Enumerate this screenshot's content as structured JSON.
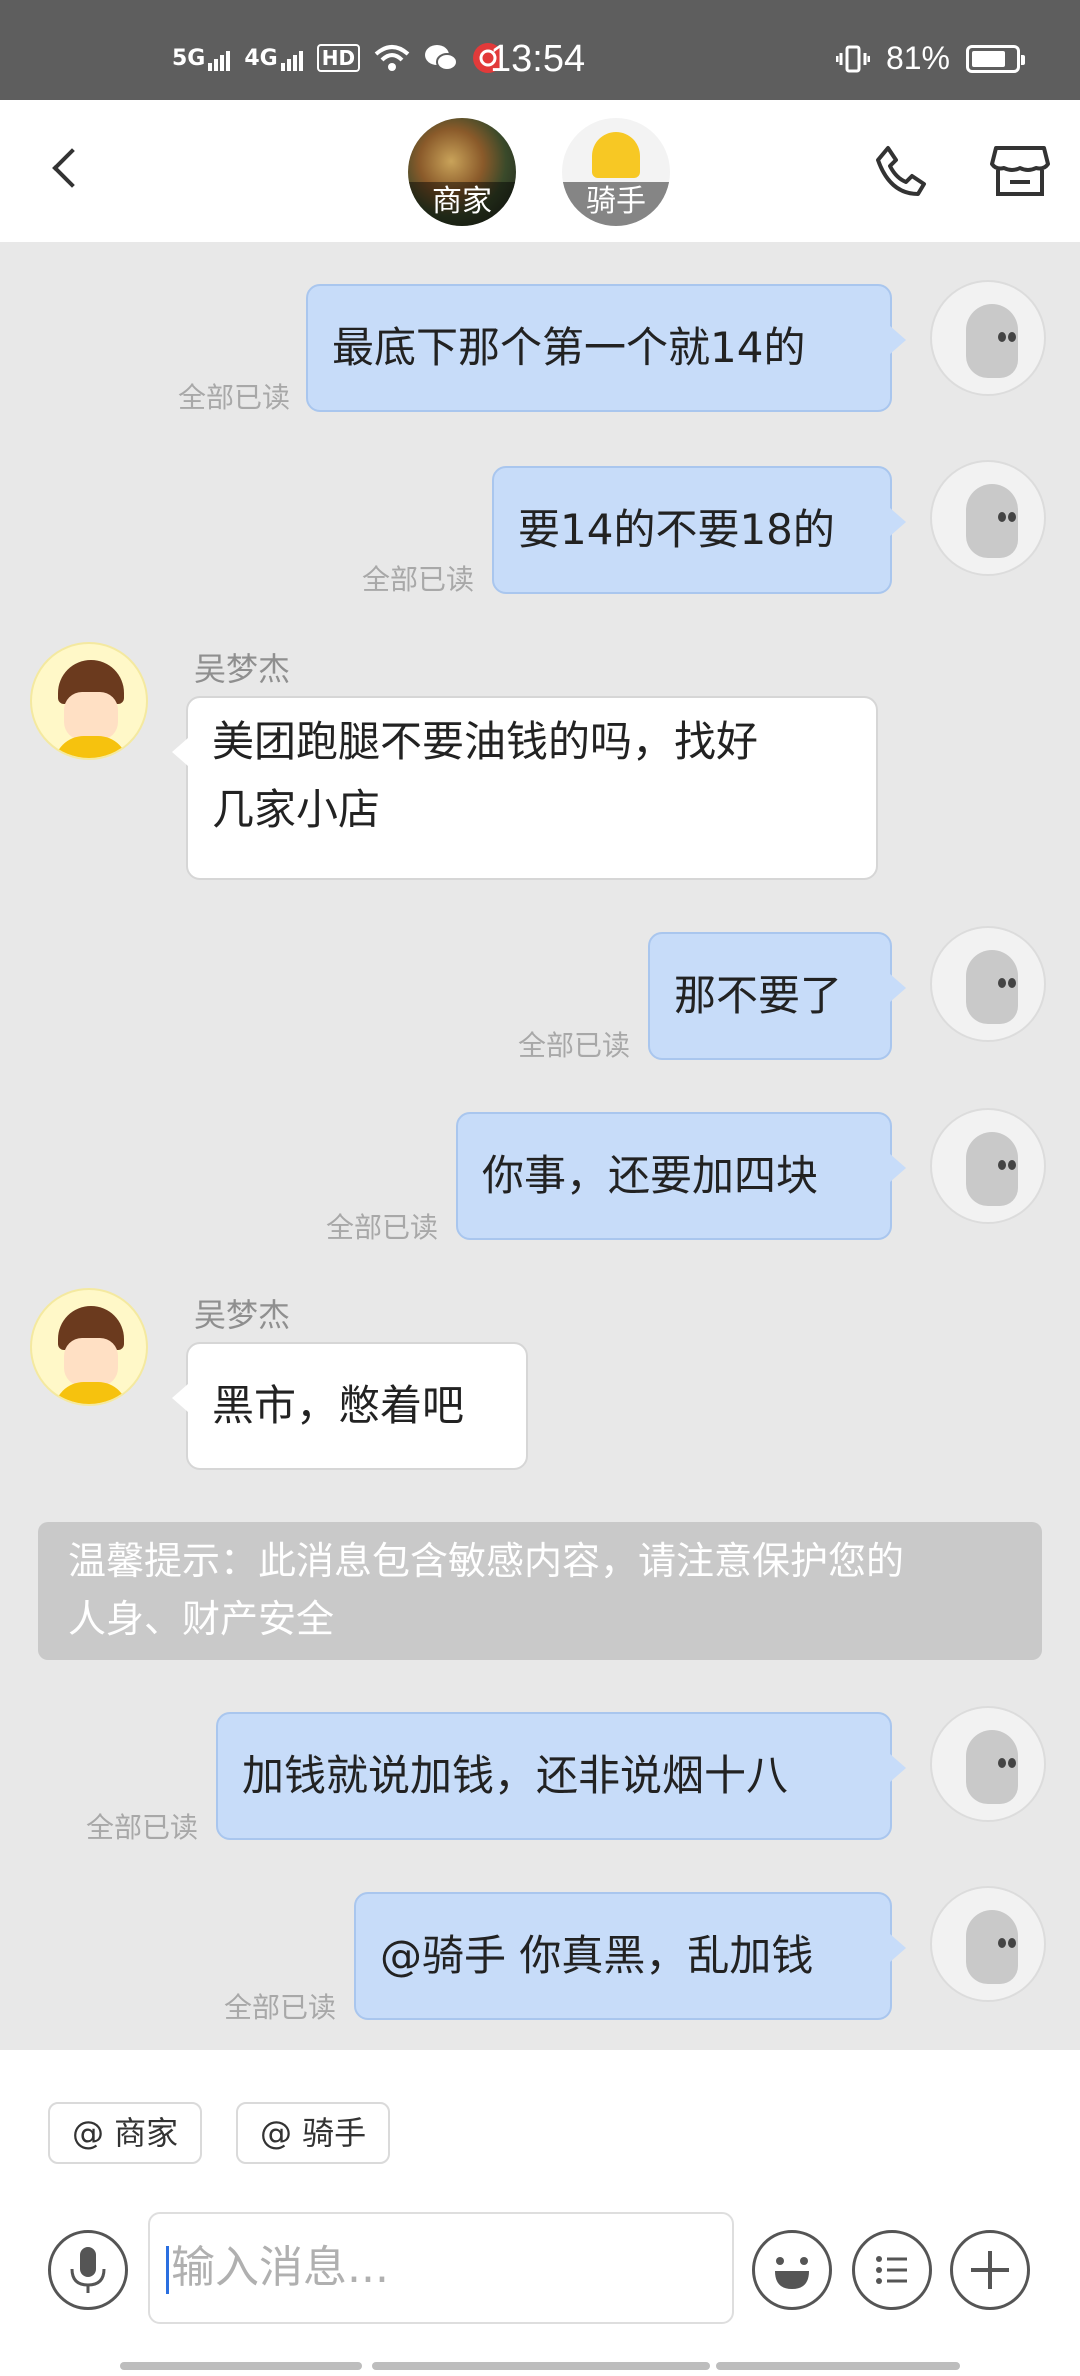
{
  "status_bar": {
    "net1": "5G",
    "net2": "4G",
    "hd": "HD",
    "time": "13:54",
    "battery": "81%",
    "battery_level": 0.81
  },
  "header": {
    "merchant_label": "商家",
    "rider_label": "骑手"
  },
  "messages": [
    {
      "from": "me",
      "text": "最底下那个第一个就14的",
      "read": "全部已读"
    },
    {
      "from": "me",
      "text": "要14的不要18的",
      "read": "全部已读"
    },
    {
      "from": "rider",
      "sender": "吴梦杰",
      "lines": [
        "美团跑腿不要油钱的吗，找好",
        "几家小店"
      ]
    },
    {
      "from": "me",
      "text": "那不要了",
      "read": "全部已读"
    },
    {
      "from": "me",
      "text": "你事，还要加四块",
      "read": "全部已读"
    },
    {
      "from": "rider",
      "sender": "吴梦杰",
      "text": "黑市，憋着吧"
    },
    {
      "from": "me",
      "text": "加钱就说加钱，还非说烟十八",
      "read": "全部已读"
    },
    {
      "from": "me",
      "text": "@骑手 你真黑，乱加钱",
      "read": "全部已读"
    }
  ],
  "notice": {
    "line1": "温馨提示：此消息包含敏感内容，请注意保护您的",
    "line2": "人身、财产安全"
  },
  "composer": {
    "mention_merchant": "@ 商家",
    "mention_rider": "@ 骑手",
    "placeholder": "输入消息..."
  },
  "icons": [
    "back-icon",
    "phone-icon",
    "store-icon",
    "mic-icon",
    "emoji-icon",
    "list-icon",
    "plus-icon"
  ]
}
